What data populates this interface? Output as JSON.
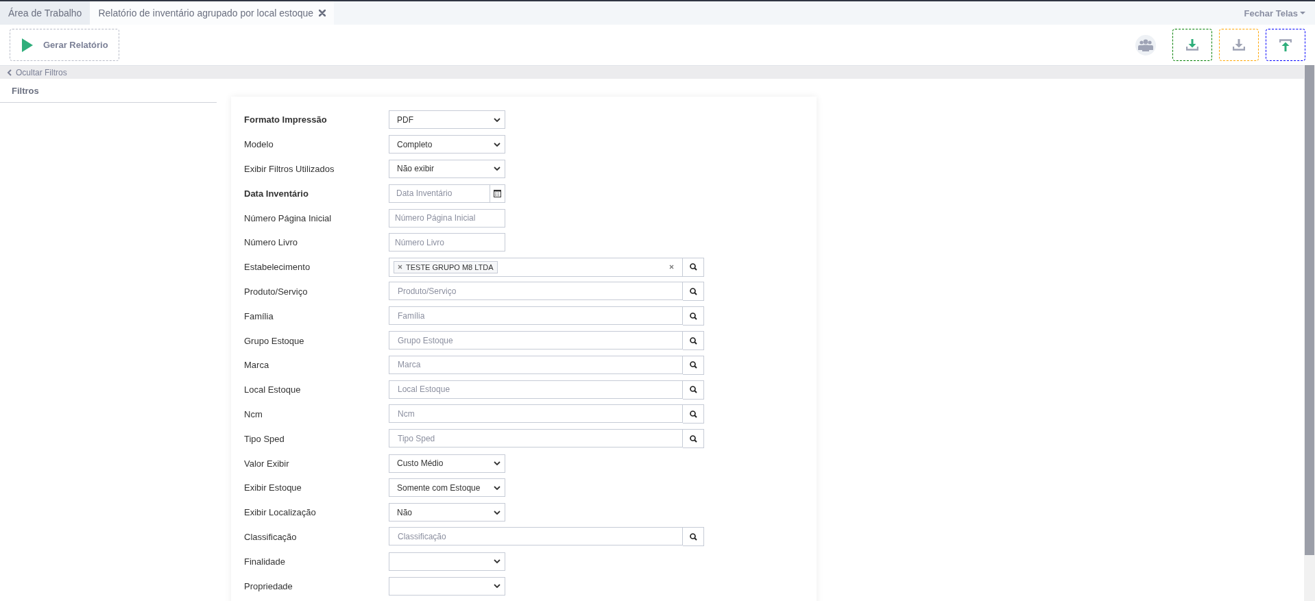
{
  "tabs": [
    {
      "label": "Área de Trabalho",
      "selected": false,
      "closable": false
    },
    {
      "label": "Relatório de inventário agrupado por local estoque",
      "selected": true,
      "closable": true
    }
  ],
  "close_all_menu": "Fechar Telas",
  "toolbar": {
    "generate_button": "Gerar Relatório",
    "actions": [
      {
        "kind": "download",
        "color": "#008000",
        "disabled": false
      },
      {
        "kind": "download",
        "color": "#ffa500",
        "disabled": true
      },
      {
        "kind": "upload",
        "color": "#0000ff",
        "disabled": false
      }
    ]
  },
  "filter_toggle": "Ocultar Filtros",
  "sidebar": {
    "title": "Filtros"
  },
  "form": {
    "fields": [
      {
        "kind": "select",
        "label": "Formato Impressão",
        "required": true,
        "value": "PDF"
      },
      {
        "kind": "select",
        "label": "Modelo",
        "required": false,
        "value": "Completo"
      },
      {
        "kind": "select",
        "label": "Exibir Filtros Utilizados",
        "required": false,
        "value": "Não exibir"
      },
      {
        "kind": "date",
        "label": "Data Inventário",
        "required": true,
        "placeholder": "Data Inventário"
      },
      {
        "kind": "text",
        "label": "Número Página Inicial",
        "required": false,
        "placeholder": "Número Página Inicial"
      },
      {
        "kind": "text",
        "label": "Número Livro",
        "required": false,
        "placeholder": "Número Livro"
      },
      {
        "kind": "lookup",
        "label": "Estabelecimento",
        "required": false,
        "tags": [
          "TESTE GRUPO M8 LTDA"
        ]
      },
      {
        "kind": "lookup",
        "label": "Produto/Serviço",
        "required": false,
        "placeholder": "Produto/Serviço"
      },
      {
        "kind": "lookup",
        "label": "Família",
        "required": false,
        "placeholder": "Família"
      },
      {
        "kind": "lookup",
        "label": "Grupo Estoque",
        "required": false,
        "placeholder": "Grupo Estoque"
      },
      {
        "kind": "lookup",
        "label": "Marca",
        "required": false,
        "placeholder": "Marca"
      },
      {
        "kind": "lookup",
        "label": "Local Estoque",
        "required": false,
        "placeholder": "Local Estoque"
      },
      {
        "kind": "lookup",
        "label": "Ncm",
        "required": false,
        "placeholder": "Ncm"
      },
      {
        "kind": "lookup",
        "label": "Tipo Sped",
        "required": false,
        "placeholder": "Tipo Sped"
      },
      {
        "kind": "select",
        "label": "Valor Exibir",
        "required": false,
        "value": "Custo Médio"
      },
      {
        "kind": "select",
        "label": "Exibir Estoque",
        "required": false,
        "value": "Somente com Estoque"
      },
      {
        "kind": "select",
        "label": "Exibir Localização",
        "required": false,
        "value": "Não"
      },
      {
        "kind": "lookup",
        "label": "Classificação",
        "required": false,
        "placeholder": "Classificação"
      },
      {
        "kind": "select",
        "label": "Finalidade",
        "required": false
      },
      {
        "kind": "select",
        "label": "Propriedade",
        "required": false
      }
    ]
  }
}
